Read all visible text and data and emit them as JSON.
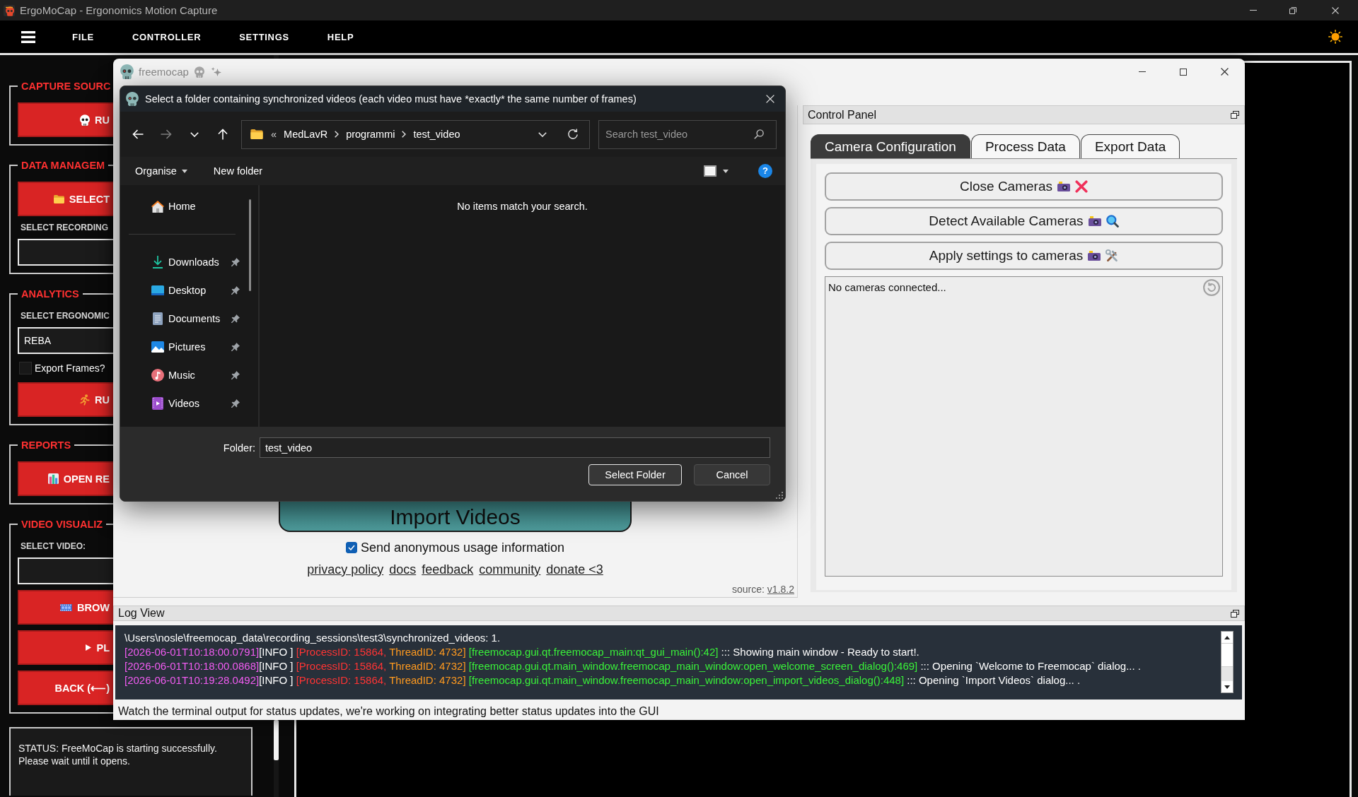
{
  "app_window": {
    "title": "ErgoMoCap - Ergonomics Motion Capture",
    "menu": [
      "FILE",
      "CONTROLLER",
      "SETTINGS",
      "HELP"
    ]
  },
  "sidebar": {
    "groups": [
      {
        "title": "CAPTURE SOURC",
        "items": [
          {
            "kind": "button",
            "label": "RU"
          }
        ]
      },
      {
        "title": "DATA MANAGEM",
        "items": [
          {
            "kind": "button",
            "label": "SELECT"
          },
          {
            "kind": "label",
            "text": "SELECT RECORDING"
          },
          {
            "kind": "field"
          }
        ]
      },
      {
        "title": "ANALYTICS",
        "items": [
          {
            "kind": "label",
            "text": "SELECT ERGONOMIC"
          },
          {
            "kind": "field",
            "value": "REBA"
          },
          {
            "kind": "checkbox",
            "label": "Export Frames?",
            "checked": false
          },
          {
            "kind": "button",
            "label": "RU"
          }
        ]
      },
      {
        "title": "REPORTS",
        "items": [
          {
            "kind": "button",
            "label": "OPEN RE"
          }
        ]
      },
      {
        "title": "VIDEO VISUALIZ",
        "items": [
          {
            "kind": "label",
            "text": "SELECT VIDEO:"
          },
          {
            "kind": "field"
          },
          {
            "kind": "button",
            "label": "BROW"
          },
          {
            "kind": "button",
            "label": "PL"
          },
          {
            "kind": "button",
            "label": "BACK (⟵)"
          }
        ]
      }
    ],
    "status": "STATUS: FreeMoCap is starting successfully.\nPlease wait until it opens."
  },
  "freemocap_window": {
    "title": "freemocap",
    "welcome_panel": {
      "import_button": "Import Videos",
      "usage_checkbox": {
        "label": "Send anonymous usage information",
        "checked": true
      },
      "links": [
        "privacy policy",
        "docs",
        "feedback",
        "community",
        "donate <3"
      ],
      "source_label": "source:",
      "version_link": "v1.8.2"
    },
    "control_panel": {
      "title": "Control Panel",
      "tabs": [
        {
          "label": "Camera Configuration",
          "selected": true
        },
        {
          "label": "Process Data",
          "selected": false
        },
        {
          "label": "Export Data",
          "selected": false
        }
      ],
      "buttons": [
        "Close Cameras",
        "Detect Available Cameras",
        "Apply settings to cameras"
      ],
      "camera_status": "No cameras connected..."
    },
    "log_view": {
      "title": "Log View",
      "lines": [
        {
          "segments": [
            {
              "kind": "message",
              "text": "\\Users\\nosle\\freemocap_data\\recording_sessions\\test3\\synchronized_videos: 1."
            }
          ]
        },
        {
          "segments": [
            {
              "kind": "timestamp",
              "text": "[2026-06-01T10:18:00.0791]"
            },
            {
              "kind": "level",
              "text": "[INFO ]"
            },
            {
              "kind": "process",
              "text": "[ProcessID: 15864,"
            },
            {
              "kind": "thread",
              "text": "ThreadID: 4732]"
            },
            {
              "kind": "source",
              "text": "[freemocap.gui.qt.freemocap_main:qt_gui_main():42]"
            },
            {
              "kind": "message",
              "text": "::: Showing main window - Ready to start!."
            }
          ]
        },
        {
          "segments": [
            {
              "kind": "timestamp",
              "text": "[2026-06-01T10:18:00.0868]"
            },
            {
              "kind": "level",
              "text": "[INFO ]"
            },
            {
              "kind": "process",
              "text": "[ProcessID: 15864,"
            },
            {
              "kind": "thread",
              "text": "ThreadID: 4732]"
            },
            {
              "kind": "source",
              "text": "[freemocap.gui.qt.main_window.freemocap_main_window:open_welcome_screen_dialog():469]"
            },
            {
              "kind": "message",
              "text": "::: Opening `Welcome to Freemocap` dialog... ."
            }
          ]
        },
        {
          "segments": [
            {
              "kind": "timestamp",
              "text": "[2026-06-01T10:19:28.0492]"
            },
            {
              "kind": "level",
              "text": "[INFO ]"
            },
            {
              "kind": "process",
              "text": "[ProcessID: 15864,"
            },
            {
              "kind": "thread",
              "text": "ThreadID: 4732]"
            },
            {
              "kind": "source",
              "text": "[freemocap.gui.qt.main_window.freemocap_main_window:open_import_videos_dialog():448]"
            },
            {
              "kind": "message",
              "text": "::: Opening `Import Videos` dialog... ."
            }
          ]
        }
      ]
    },
    "status_bar": "Watch the terminal output for status updates, we're working on integrating better status updates into the GUI"
  },
  "folder_dialog": {
    "title": "Select a folder containing synchronized videos (each video must have *exactly* the same number of frames)",
    "nav_buttons": [
      {
        "disabled": false
      },
      {
        "disabled": true
      },
      {
        "disabled": false
      },
      {
        "disabled": false
      }
    ],
    "breadcrumb_overflow": "«",
    "breadcrumb": [
      "MedLavR",
      "programmi",
      "test_video"
    ],
    "search_placeholder": "Search test_video",
    "organise": "Organise",
    "new_folder": "New folder",
    "help": "?",
    "nav_sections": [
      {
        "items": [
          {
            "label": "Home",
            "pinned": false
          }
        ]
      },
      {
        "items": [
          {
            "label": "Downloads",
            "pinned": true
          },
          {
            "label": "Desktop",
            "pinned": true
          },
          {
            "label": "Documents",
            "pinned": true
          },
          {
            "label": "Pictures",
            "pinned": true
          },
          {
            "label": "Music",
            "pinned": true
          },
          {
            "label": "Videos",
            "pinned": true
          }
        ]
      }
    ],
    "empty_message": "No items match your search.",
    "folder_label": "Folder:",
    "folder_value": "test_video",
    "buttons": [
      {
        "label": "Select Folder",
        "default": true
      },
      {
        "label": "Cancel",
        "default": false
      }
    ]
  }
}
